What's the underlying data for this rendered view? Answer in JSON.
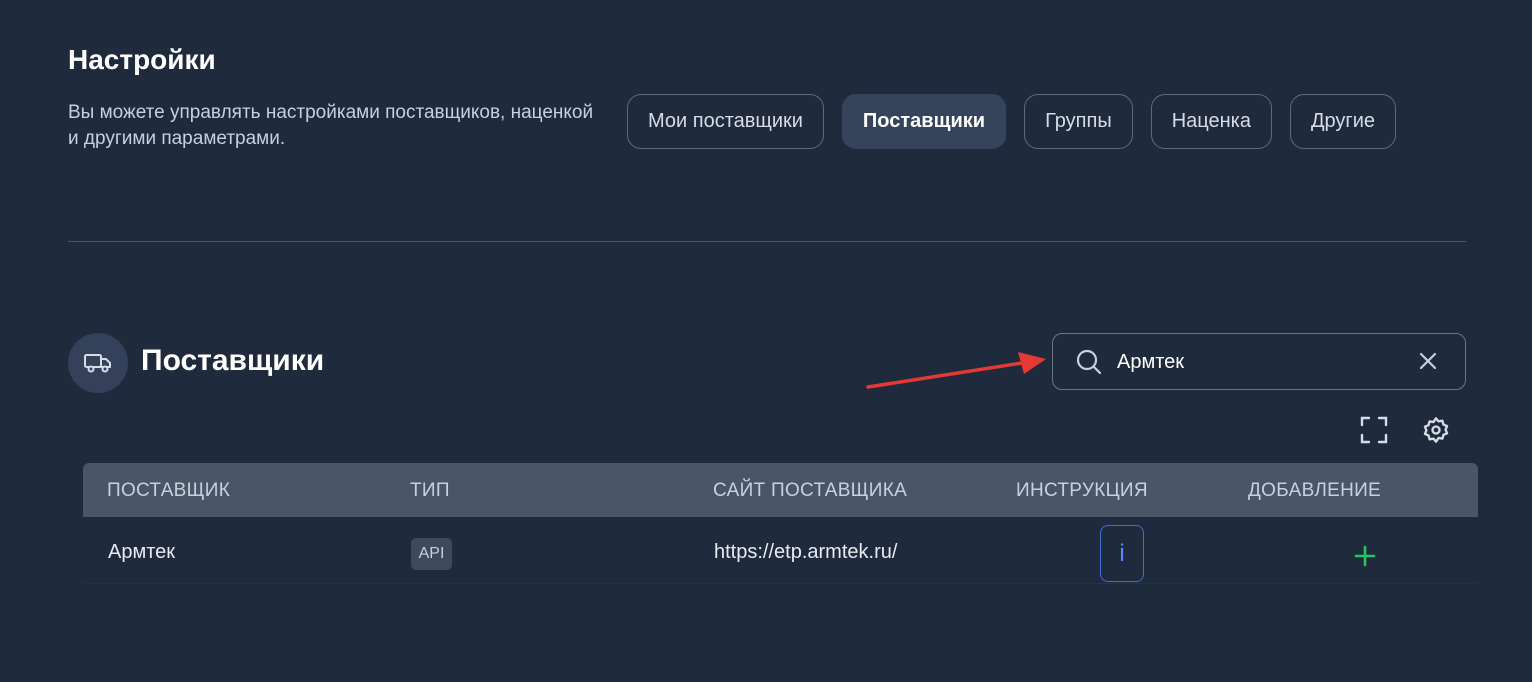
{
  "header": {
    "title": "Настройки",
    "description": "Вы можете управлять настройками поставщиков, наценкой и другими параметрами."
  },
  "tabs": [
    {
      "label": "Мои поставщики",
      "active": false
    },
    {
      "label": "Поставщики",
      "active": true
    },
    {
      "label": "Группы",
      "active": false
    },
    {
      "label": "Наценка",
      "active": false
    },
    {
      "label": "Другие",
      "active": false
    }
  ],
  "section": {
    "title": "Поставщики",
    "icon": "truck-icon"
  },
  "search": {
    "value": "Армтек",
    "icon": "search-icon",
    "clear_icon": "close-icon"
  },
  "toolbar": {
    "icons": [
      "fullscreen-icon",
      "gear-icon"
    ]
  },
  "table": {
    "columns": [
      "ПОСТАВЩИК",
      "ТИП",
      "САЙТ ПОСТАВЩИКА",
      "ИНСТРУКЦИЯ",
      "ДОБАВЛЕНИЕ"
    ],
    "rows": [
      {
        "supplier": "Армтек",
        "type": "API",
        "site": "https://etp.armtek.ru/",
        "instruction": "i",
        "add_icon": "plus-icon"
      }
    ]
  },
  "colors": {
    "background": "#1f2a3c",
    "active_tab": "#35445a",
    "table_header": "#4a5568",
    "info_accent": "#4f8cff",
    "add_accent": "#22c55e",
    "annotation_arrow": "#e53935"
  }
}
